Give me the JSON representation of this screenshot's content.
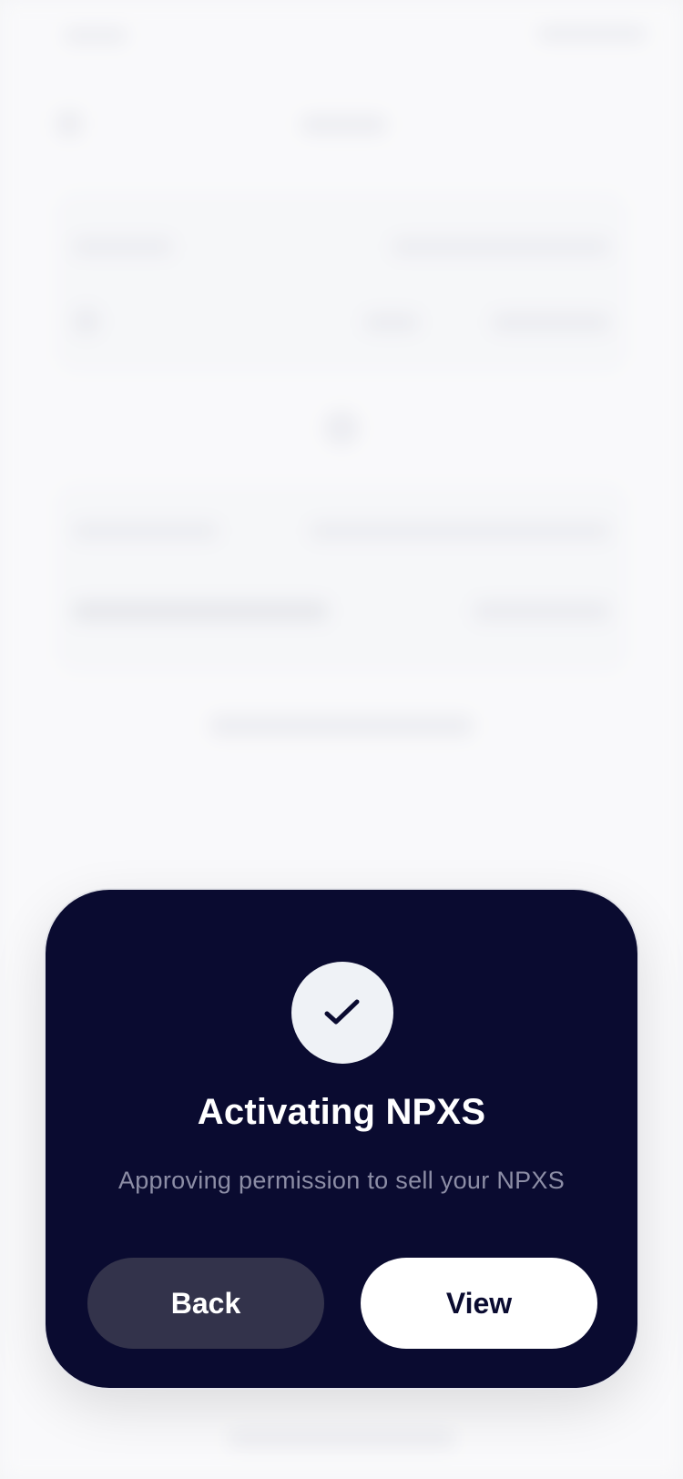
{
  "modal": {
    "icon": "check-icon",
    "title": "Activating NPXS",
    "subtitle": "Approving permission to sell your NPXS",
    "back_label": "Back",
    "view_label": "View"
  },
  "colors": {
    "sheet_background": "#0a0b30",
    "icon_circle": "#eff2f6",
    "back_button": "#33334b",
    "view_button": "#ffffff",
    "subtitle_text": "#8d8ea6"
  }
}
